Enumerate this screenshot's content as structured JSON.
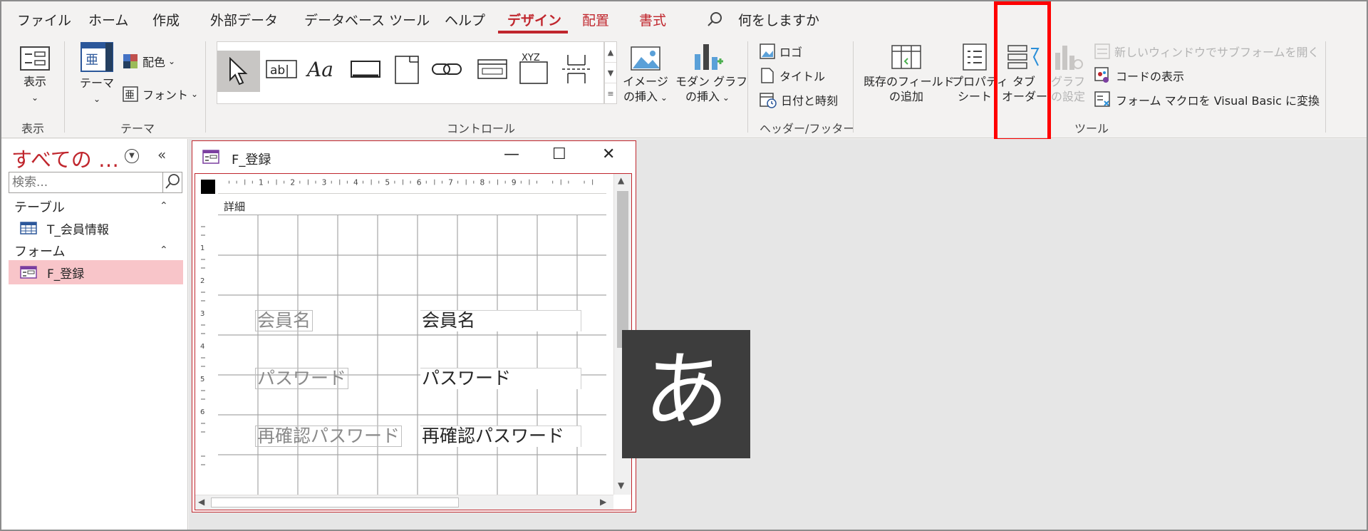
{
  "menu": {
    "tabs": [
      {
        "label": "ファイル"
      },
      {
        "label": "ホーム"
      },
      {
        "label": "作成"
      },
      {
        "label": "外部データ"
      },
      {
        "label": "データベース ツール"
      },
      {
        "label": "ヘルプ"
      },
      {
        "label": "デザイン",
        "active": true
      },
      {
        "label": "配置"
      },
      {
        "label": "書式"
      }
    ],
    "tell_me": "何をしますか"
  },
  "ribbon": {
    "view": {
      "button": "表示",
      "group": "表示"
    },
    "theme": {
      "theme_line1": "テーマ",
      "colors": "配色",
      "fonts": "フォント",
      "group": "テーマ",
      "font_glyph": "亜"
    },
    "controls": {
      "group": "コントロール",
      "textbox_glyph": "ab|",
      "label_glyph": "Aa",
      "xyz_glyph": "XYZ",
      "image_line1": "イメージ",
      "image_line2": "の挿入",
      "chart_line1": "モダン グラフ",
      "chart_line2": "の挿入"
    },
    "header_footer": {
      "logo": "ロゴ",
      "title": "タイトル",
      "datetime": "日付と時刻",
      "group": "ヘッダー/フッター"
    },
    "tools": {
      "add_fields_line1": "既存のフィールド",
      "add_fields_line2": "の追加",
      "property_line1": "プロパティ",
      "property_line2": "シート",
      "tab_order_line1": "タブ",
      "tab_order_line2": "オーダー",
      "chart_settings_line1": "グラフ",
      "chart_settings_line2": "の設定",
      "open_subform": "新しいウィンドウでサブフォームを開く",
      "view_code": "コードの表示",
      "convert_macros": "フォーム マクロを Visual Basic に変換",
      "group": "ツール"
    }
  },
  "nav": {
    "title": "すべての …",
    "search_placeholder": "検索...",
    "sections": [
      {
        "label": "テーブル",
        "items": [
          {
            "label": "T_会員情報"
          }
        ]
      },
      {
        "label": "フォーム",
        "items": [
          {
            "label": "F_登録",
            "selected": true
          }
        ]
      }
    ]
  },
  "form_window": {
    "title": "F_登録",
    "section": "詳細",
    "ruler_top": [
      "1",
      "2",
      "3",
      "4",
      "5",
      "6",
      "7",
      "8",
      "9"
    ],
    "ruler_left": [
      "1",
      "2",
      "3",
      "4",
      "5",
      "6"
    ],
    "controls": [
      {
        "label": "会員名",
        "field": "会員名"
      },
      {
        "label": "パスワード",
        "field": "パスワード"
      },
      {
        "label": "再確認パスワード",
        "field": "再確認パスワード"
      }
    ]
  },
  "ime_indicator": "あ",
  "colors": {
    "accent": "#c0262d",
    "highlight_box": "#ff0000",
    "nav_selected": "#f8c5c9"
  }
}
